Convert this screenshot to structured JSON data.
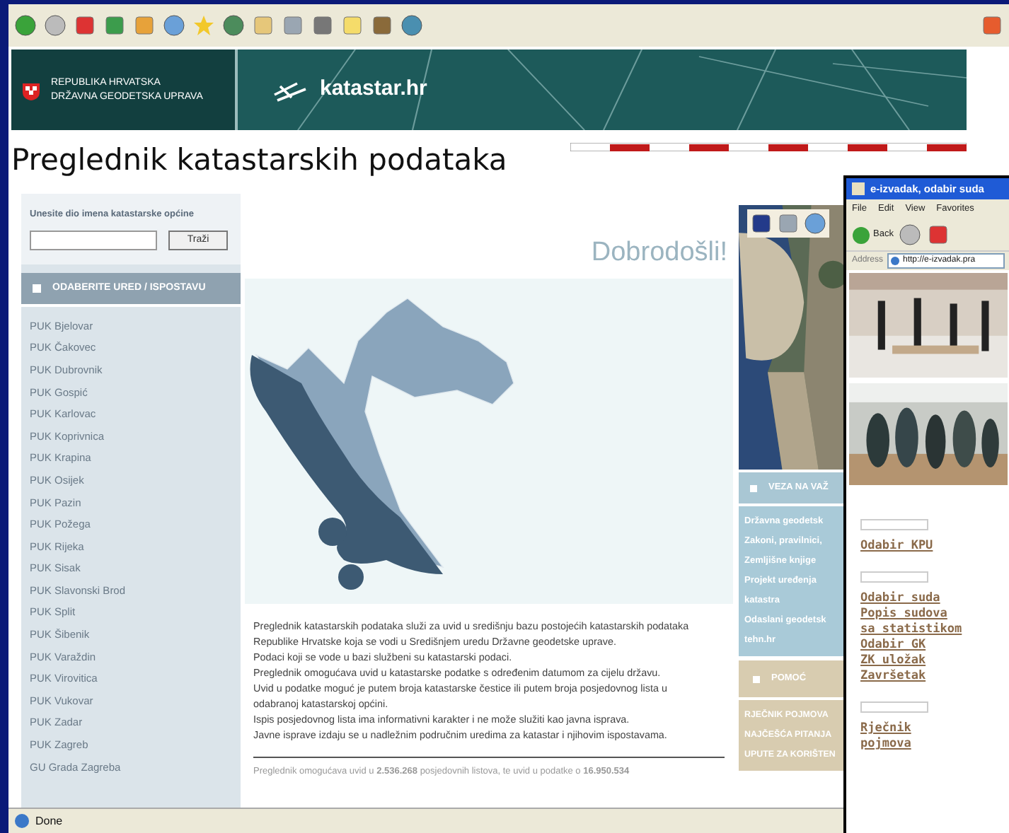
{
  "header": {
    "org_lines": [
      "REPUBLIKA HRVATSKA",
      "DRŽAVNA GEODETSKA UPRAVA"
    ],
    "logo": "katastar.hr"
  },
  "page_title": "Preglednik katastarskih podataka",
  "search": {
    "label": "Unesite dio imena katastarske općine",
    "button": "Traži"
  },
  "offices": {
    "heading": "ODABERITE URED / ISPOSTAVU",
    "items": [
      "PUK Bjelovar",
      "PUK Čakovec",
      "PUK Dubrovnik",
      "PUK Gospić",
      "PUK Karlovac",
      "PUK Koprivnica",
      "PUK Krapina",
      "PUK Osijek",
      "PUK Pazin",
      "PUK Požega",
      "PUK Rijeka",
      "PUK Sisak",
      "PUK Slavonski Brod",
      "PUK Split",
      "PUK Šibenik",
      "PUK Varaždin",
      "PUK Virovitica",
      "PUK Vukovar",
      "PUK Zadar",
      "PUK Zagreb",
      "GU Grada Zagreba"
    ]
  },
  "welcome": "Dobrodošli!",
  "intro_lines": [
    "Preglednik katastarskih podataka služi za uvid u središnju bazu postojećih katastarskih podataka",
    "Republike Hrvatske koja se vodi u Središnjem uredu Državne geodetske uprave.",
    "Podaci koji se vode u bazi službeni su katastarski podaci.",
    "Preglednik omogućava uvid u katastarske podatke s određenim datumom za cijelu državu.",
    "Uvid u podatke moguć je putem broja katastarske čestice ili putem broja posjedovnog lista u",
    "odabranoj katastarskoj općini.",
    "Ispis posjedovnog lista ima informativni karakter i ne može služiti kao javna isprava.",
    "Javne isprave izdaju se u nadležnim područnim uredima za katastar i njihovim ispostavama."
  ],
  "stats": "Preglednik omogućava uvid u **2.536.268** posjedovnih listova, te uvid u podatke o **16.950.534**",
  "links_panel": {
    "heading": "VEZA NA VAŽ",
    "items": [
      "Državna geodetsk",
      "Zakoni, pravilnici,",
      "Zemljišne knjige",
      "Projekt uređenja",
      "katastra",
      "Odaslani geodetsk",
      "tehn.hr"
    ]
  },
  "help_panel": {
    "heading": "POMOĆ",
    "items": [
      "RJEČNIK POJMOVA",
      "NAJČEŠĆA PITANJA",
      "UPUTE ZA KORIŠTEN"
    ]
  },
  "status": "Done",
  "popup": {
    "title": "e-izvadak, odabir suda",
    "menu": [
      "File",
      "Edit",
      "View",
      "Favorites"
    ],
    "back": "Back",
    "address_label": "Address",
    "url": "http://e-izvadak.pra",
    "sections": [
      {
        "links": [
          "Odabir KPU"
        ]
      },
      {
        "links": [
          "Odabir suda",
          "Popis sudova",
          "sa statistikom",
          "Odabir GK",
          "ZK uložak",
          "Završetak"
        ]
      },
      {
        "links": [
          "Rječnik",
          "pojmova"
        ]
      }
    ]
  }
}
